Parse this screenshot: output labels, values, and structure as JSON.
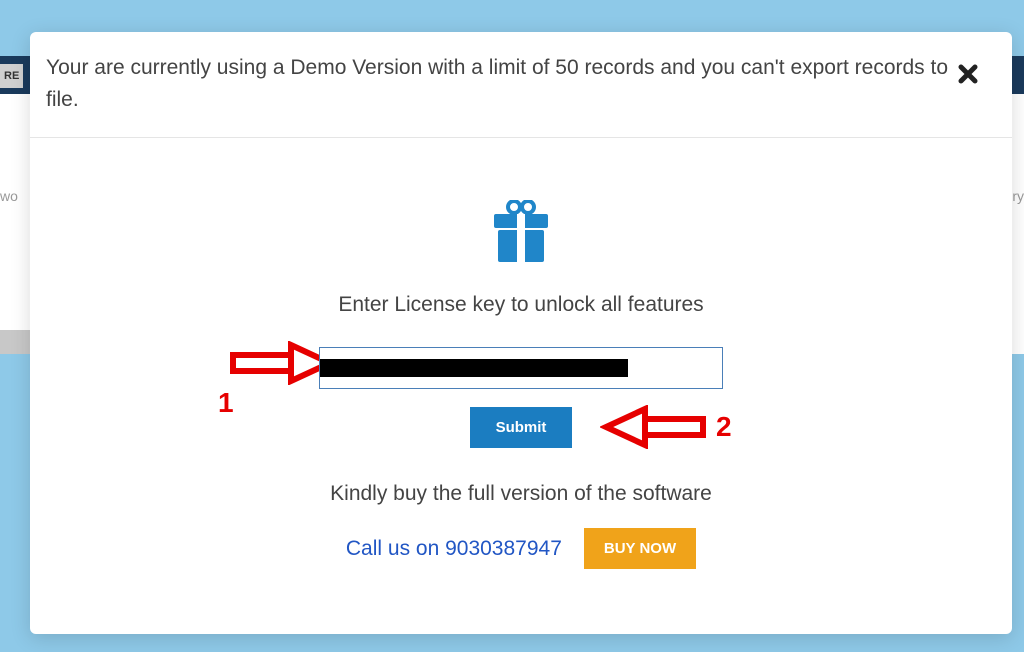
{
  "background": {
    "left_fragment": "wo",
    "right_fragment": "ry",
    "re_fragment": "RE"
  },
  "modal": {
    "header_text": "Your are currently using a Demo Version with a limit of 50 records and you can't export records to file.",
    "license_prompt": "Enter License key to unlock all features",
    "submit_label": "Submit",
    "buy_text": "Kindly buy the full version of the software",
    "call_text": "Call us on 9030387947",
    "buynow_label": "BUY NOW"
  },
  "annotations": {
    "arrow1_label": "1",
    "arrow2_label": "2"
  }
}
